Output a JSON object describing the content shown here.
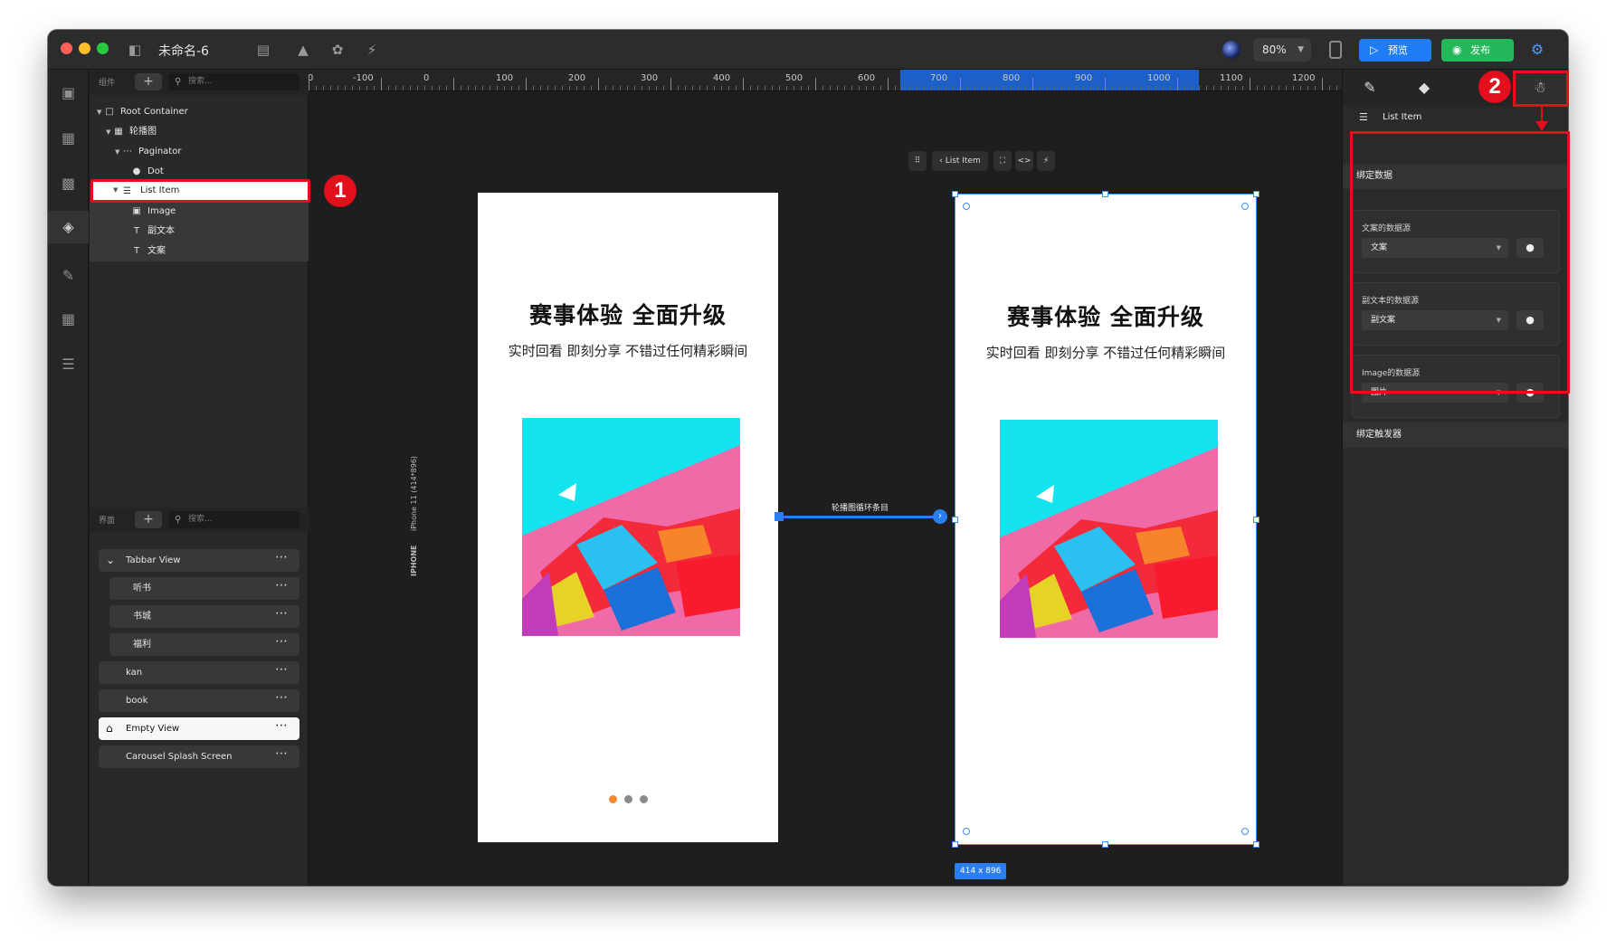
{
  "window": {
    "title": "未命名-6"
  },
  "titlebar": {
    "zoom": "80%",
    "preview_label": "预览",
    "publish_label": "发布"
  },
  "layers_panel": {
    "label": "组件",
    "search_placeholder": "搜索...",
    "tree": [
      {
        "label": "Root Container",
        "icon": "square-icon"
      },
      {
        "label": "轮播图",
        "icon": "grid-icon"
      },
      {
        "label": "Paginator",
        "icon": "dots-icon"
      },
      {
        "label": "Dot",
        "icon": "shapes-icon"
      },
      {
        "label": "List Item",
        "icon": "list-icon"
      },
      {
        "label": "Image",
        "icon": "image-icon"
      },
      {
        "label": "副文本",
        "icon": "text-icon"
      },
      {
        "label": "文案",
        "icon": "text-icon"
      }
    ]
  },
  "screens_panel": {
    "label": "界面",
    "search_placeholder": "搜索...",
    "items": [
      {
        "label": "Tabbar View"
      },
      {
        "label": "听书"
      },
      {
        "label": "书城"
      },
      {
        "label": "福利"
      },
      {
        "label": "kan"
      },
      {
        "label": "book"
      },
      {
        "label": "Empty View"
      },
      {
        "label": "Carousel Splash Screen"
      }
    ]
  },
  "ruler": {
    "ticks": [
      "0",
      "-100",
      "0",
      "100",
      "200",
      "300",
      "400",
      "500",
      "600",
      "700",
      "800",
      "900",
      "1000",
      "1100",
      "1200"
    ]
  },
  "canvas": {
    "device_label": "iPhone 11 (414*896)",
    "device_type": "IPHONE",
    "hero_title": "赛事体验 全面升级",
    "hero_subtitle": "实时回看 即刻分享 不错过任何精彩瞬间",
    "connector_label": "轮播图循环条目",
    "floating_toolbar_label": "List Item",
    "size_tag": "414 x 896"
  },
  "inspector": {
    "selected_name": "List Item",
    "bind_data_title": "绑定数据",
    "bindings": [
      {
        "label": "文案的数据源",
        "value": "文案"
      },
      {
        "label": "副文本的数据源",
        "value": "副文案"
      },
      {
        "label": "Image的数据源",
        "value": "图片"
      }
    ],
    "bind_trigger_title": "绑定触发器"
  },
  "annotations": {
    "badge1": "1",
    "badge2": "2"
  },
  "colors": {
    "accent": "#1f7cf2",
    "publish": "#25b85b",
    "highlight": "#e30f1d",
    "paginator_active": "#f28a30"
  }
}
